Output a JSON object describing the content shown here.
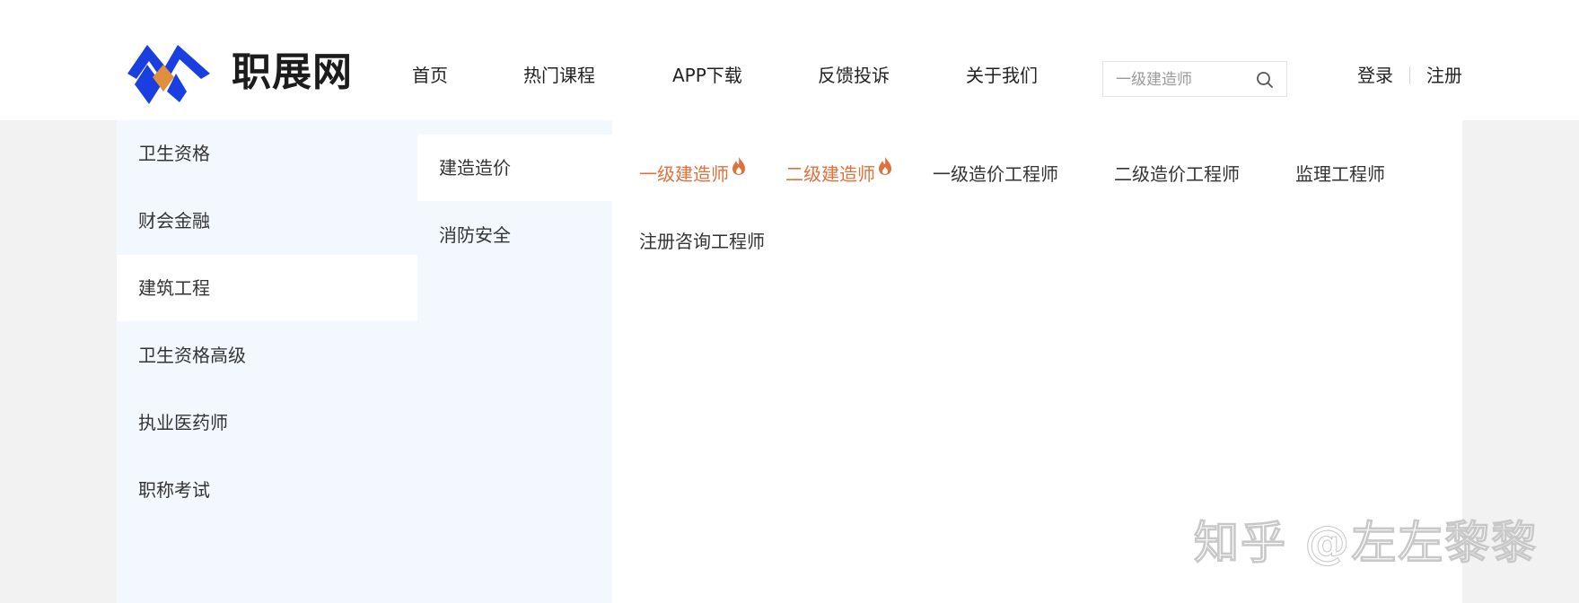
{
  "brand": {
    "name": "职展网",
    "logo_colors": {
      "primary": "#1a3fe0",
      "accent": "#e0903c"
    }
  },
  "nav": [
    {
      "label": "首页"
    },
    {
      "label": "热门课程"
    },
    {
      "label": "APP下载"
    },
    {
      "label": "反馈投诉"
    },
    {
      "label": "关于我们"
    }
  ],
  "search": {
    "placeholder": "一级建造师",
    "icon": "search-icon"
  },
  "auth": {
    "login": "登录",
    "register": "注册"
  },
  "categories": [
    {
      "label": "卫生资格"
    },
    {
      "label": "财会金融"
    },
    {
      "label": "建筑工程",
      "active": true
    },
    {
      "label": "卫生资格高级"
    },
    {
      "label": "执业医药师"
    },
    {
      "label": "职称考试"
    }
  ],
  "subcategories": [
    {
      "label": "建造造价",
      "active": true
    },
    {
      "label": "消防安全"
    }
  ],
  "courses": [
    {
      "label": "一级建造师",
      "hot": true
    },
    {
      "label": "二级建造师",
      "hot": true
    },
    {
      "label": "一级造价工程师",
      "hot": false
    },
    {
      "label": "二级造价工程师",
      "hot": false
    },
    {
      "label": "监理工程师",
      "hot": false
    },
    {
      "label": "注册咨询工程师",
      "hot": false
    }
  ],
  "colors": {
    "hot_text": "#e0703c",
    "sidebar_bg": "#f3f8fe",
    "page_bg": "#f2f2f2"
  },
  "watermark": "知乎 @左左黎黎"
}
